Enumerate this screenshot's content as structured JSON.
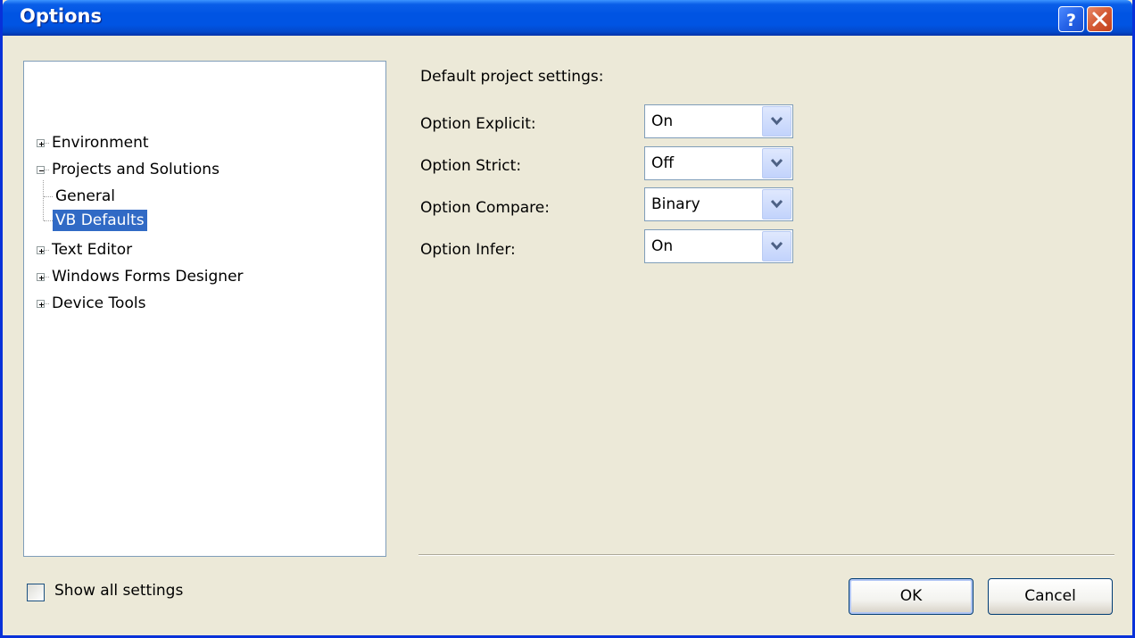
{
  "window": {
    "title": "Options"
  },
  "titlebar_buttons": {
    "help_icon": "help-icon",
    "close_icon": "close-icon"
  },
  "tree": {
    "nodes": [
      {
        "label": "Environment",
        "expander": "plus"
      },
      {
        "label": "Projects and Solutions",
        "expander": "minus"
      },
      {
        "label": "General",
        "expander": "none"
      },
      {
        "label": "VB Defaults",
        "expander": "none",
        "selected": true
      },
      {
        "label": "Text Editor",
        "expander": "plus"
      },
      {
        "label": "Windows Forms Designer",
        "expander": "plus"
      },
      {
        "label": "Device Tools",
        "expander": "plus"
      }
    ]
  },
  "settings": {
    "heading": "Default project settings:",
    "fields": [
      {
        "label": "Option Explicit:",
        "value": "On"
      },
      {
        "label": "Option Strict:",
        "value": "Off"
      },
      {
        "label": "Option Compare:",
        "value": "Binary"
      },
      {
        "label": "Option Infer:",
        "value": "On"
      }
    ]
  },
  "footer": {
    "show_all_label": "Show all settings",
    "show_all_checked": false,
    "ok_label": "OK",
    "cancel_label": "Cancel"
  },
  "colors": {
    "titlebar": "#0054e3",
    "selection": "#316ac5",
    "dialog_bg": "#ece9d8"
  }
}
